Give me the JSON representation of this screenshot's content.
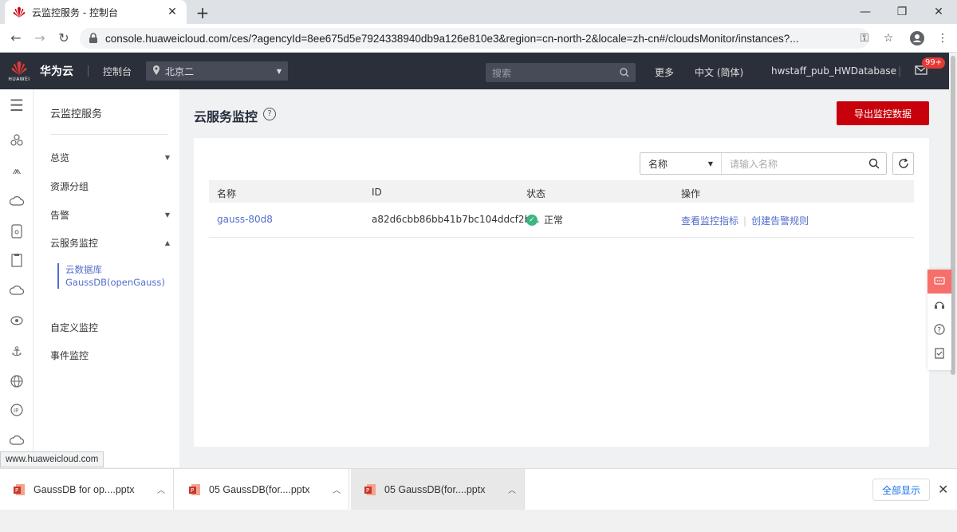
{
  "browser": {
    "tab_title": "云监控服务 - 控制台",
    "new_tab": "+",
    "url": "console.huaweicloud.com/ces/?agencyId=8ee675d5e7924338940db9a126e810e3&region=cn-north-2&locale=zh-cn#/cloudsMonitor/instances?..."
  },
  "header": {
    "logo_text": "HUAWEI",
    "brand": "华为云",
    "console": "控制台",
    "region": "北京二",
    "search_placeholder": "搜索",
    "more": "更多",
    "language": "中文 (简体)",
    "username": "hwstaff_pub_HWDatabase",
    "mail_badge": "99+"
  },
  "sidenav": {
    "service_title": "云监控服务",
    "items": [
      {
        "label": "总览"
      },
      {
        "label": "资源分组"
      },
      {
        "label": "告警"
      },
      {
        "label": "云服务监控"
      },
      {
        "label": "自定义监控"
      },
      {
        "label": "事件监控"
      }
    ],
    "active_sub": "云数据库 GaussDB(openGauss)"
  },
  "main": {
    "title": "云服务监控",
    "export_button": "导出监控数据",
    "filter": {
      "field": "名称",
      "placeholder": "请输入名称"
    },
    "table": {
      "headers": [
        "名称",
        "ID",
        "状态",
        "操作"
      ],
      "rows": [
        {
          "name": "gauss-80d8",
          "id": "a82d6cbb86bb41b7bc104ddcf2b...",
          "status": "正常",
          "op1": "查看监控指标",
          "op2": "创建告警规则"
        }
      ]
    }
  },
  "status_url": "www.huaweicloud.com",
  "downloads": {
    "items": [
      {
        "name": "GaussDB for op....pptx"
      },
      {
        "name": "05 GaussDB(for....pptx"
      },
      {
        "name": "05 GaussDB(for....pptx"
      }
    ],
    "show_all": "全部显示"
  },
  "colors": {
    "accent_red": "#c7000b",
    "link_blue": "#526ecc",
    "status_green": "#3db680",
    "header_dark": "#2b2f3a"
  }
}
